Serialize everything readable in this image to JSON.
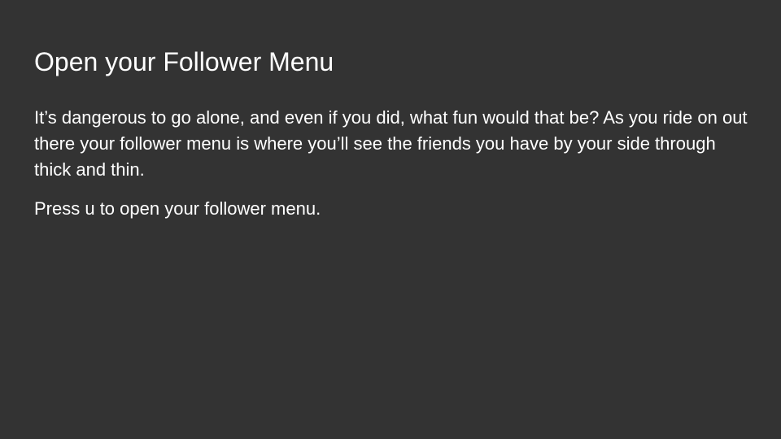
{
  "slide": {
    "title": "Open your Follower Menu",
    "paragraphs": [
      "It’s dangerous to go alone, and even if you did, what fun would that be? As you ride on out there your follower menu is where you’ll see the friends you have by your side through thick and thin.",
      "Press u to open your follower menu."
    ]
  },
  "colors": {
    "background": "#333333",
    "text": "#ffffff"
  }
}
